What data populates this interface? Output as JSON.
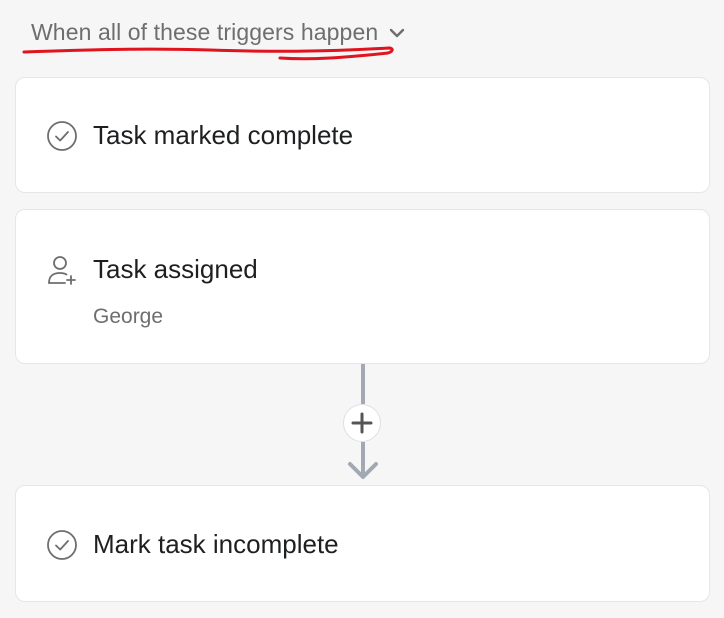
{
  "header": {
    "trigger_mode_label": "When all of these triggers happen",
    "chevron_icon": "chevron-down-icon"
  },
  "triggers": [
    {
      "icon": "check-circle-icon",
      "title": "Task marked complete"
    },
    {
      "icon": "person-add-icon",
      "title": "Task assigned",
      "subtitle": "George"
    }
  ],
  "connector": {
    "add_icon": "plus-icon",
    "arrow_icon": "arrow-down-icon"
  },
  "actions": [
    {
      "icon": "check-circle-icon",
      "title": "Mark task incomplete"
    }
  ],
  "colors": {
    "background": "#f6f6f6",
    "card": "#ffffff",
    "annotation_underline": "#e0141e",
    "connector": "#a2a9b2"
  }
}
